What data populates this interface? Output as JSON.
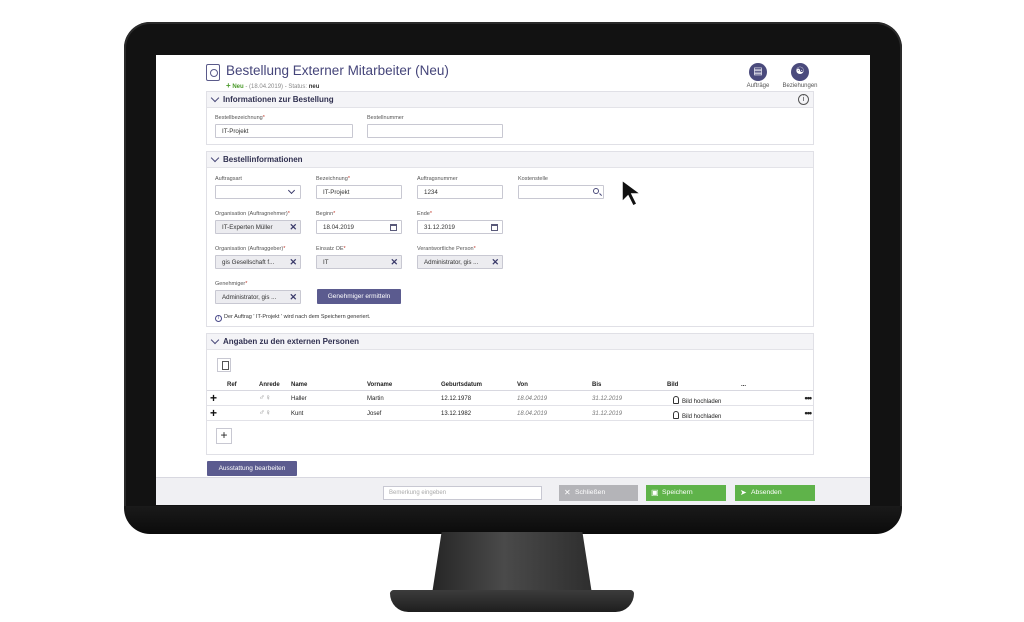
{
  "header": {
    "title": "Bestellung Externer Mitarbeiter (Neu)",
    "new_label": "Neu",
    "sub_meta": "- (18.04.2019) - Status:",
    "status_value": "neu",
    "toolbar": [
      {
        "label": "Aufträge",
        "icon": "orders-icon"
      },
      {
        "label": "Beziehungen",
        "icon": "handshake-icon"
      }
    ]
  },
  "section_order_info": {
    "title": "Informationen zur Bestellung",
    "fields": {
      "bestellbezeichnung": {
        "label": "Bestellbezeichnung",
        "value": "IT-Projekt"
      },
      "bestellnummer": {
        "label": "Bestellnummer",
        "value": ""
      }
    }
  },
  "section_details": {
    "title": "Bestellinformationen",
    "fields": {
      "auftragsart": {
        "label": "Auftragsart",
        "value": ""
      },
      "bezeichnung": {
        "label": "Bezeichnung",
        "value": "IT-Projekt"
      },
      "auftragsnummer": {
        "label": "Auftragsnummer",
        "value": "1234"
      },
      "kostenstelle": {
        "label": "Kostenstelle",
        "value": ""
      },
      "org_nehmer": {
        "label": "Organisation (Auftragnehmer)",
        "value": "IT-Experten Müller"
      },
      "beginn": {
        "label": "Beginn",
        "value": "18.04.2019"
      },
      "ende": {
        "label": "Ende",
        "value": "31.12.2019"
      },
      "org_geber": {
        "label": "Organisation (Auftraggeber)",
        "value": "gis Gesellschaft f..."
      },
      "einsatz_oe": {
        "label": "Einsatz OE",
        "value": "IT"
      },
      "verantwortlich": {
        "label": "Verantwortliche Person",
        "value": "Administrator, gis ..."
      },
      "genehmiger": {
        "label": "Genehmiger",
        "value": "Administrator, gis ..."
      }
    },
    "genehmiger_button": "Genehmiger ermitteln",
    "note": "Der Auftrag ' IT-Projekt ' wird nach dem Speichern generiert."
  },
  "section_persons": {
    "title": "Angaben zu den externen Personen",
    "columns": [
      "Ref",
      "Anrede",
      "Name",
      "Vorname",
      "Geburtsdatum",
      "Von",
      "Bis",
      "Bild",
      "..."
    ],
    "rows": [
      {
        "name": "Haller",
        "vorname": "Martin",
        "geburtsdatum": "12.12.1978",
        "von": "18.04.2019",
        "bis": "31.12.2019",
        "bild": "Bild hochladen"
      },
      {
        "name": "Kunt",
        "vorname": "Josef",
        "geburtsdatum": "13.12.1982",
        "von": "18.04.2019",
        "bis": "31.12.2019",
        "bild": "Bild hochladen"
      }
    ]
  },
  "equipment_button": "Ausstattung bearbeiten",
  "footer": {
    "remark_placeholder": "Bemerkung eingeben",
    "close_label": "Schließen",
    "save_label": "Speichern",
    "send_label": "Absenden"
  },
  "colors": {
    "accent": "#5b5b8f",
    "green": "#5fb34a",
    "required": "#c0392b"
  }
}
